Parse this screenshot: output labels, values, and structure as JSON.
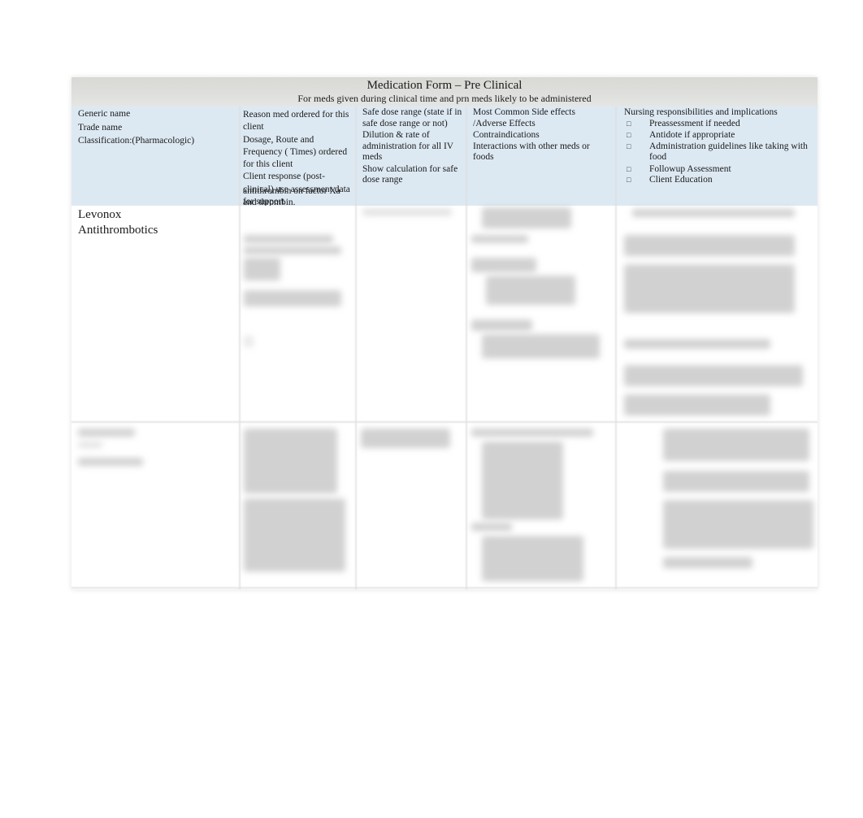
{
  "form": {
    "title": "Medication Form – Pre Clinical",
    "subtitle": "For meds given during clinical time and prn meds likely to be administered"
  },
  "header": {
    "col1": [
      "Generic name",
      "Trade name",
      "Classification:(Pharmacologic)"
    ],
    "col2": [
      "Reason med ordered for this client",
      "Dosage,  Route and Frequency ( Times) ordered for this client",
      "Client response (post-clinical) use assessment data for support"
    ],
    "col3": [
      "Safe dose range   (state if in safe dose range or not)",
      "Dilution & rate of administration for all IV meds",
      "Show calculation for safe dose range"
    ],
    "col4": [
      "Most Common Side effects /Adverse Effects",
      "Contraindications",
      "Interactions with other meds or foods"
    ],
    "col5_title": "Nursing responsibilities and implications",
    "col5_items": [
      "Preassessment if needed",
      "Antidote if appropriate",
      "Administration guidelines like taking with food",
      "Followup Assessment",
      "Client Education"
    ],
    "bullet_icon": "□"
  },
  "rows": [
    {
      "generic_name": "Levonox",
      "classification": "Antithrombotics",
      "reason_continuation": "antithrombin on factor Xa and thrombin.",
      "other_content": "blurred"
    },
    {
      "other_content": "blurred"
    }
  ]
}
